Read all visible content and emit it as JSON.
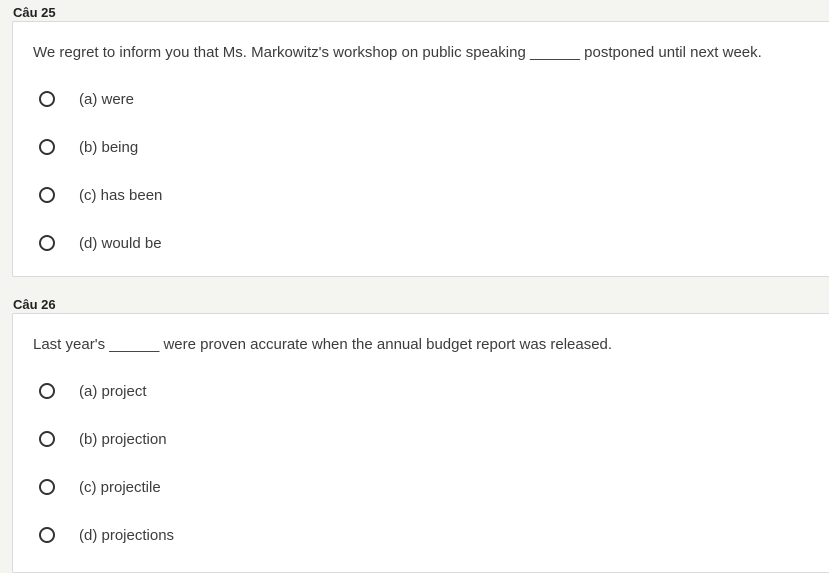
{
  "questions": [
    {
      "label": "Câu 25",
      "text": "We regret to inform you that Ms. Markowitz's workshop on public speaking ______ postponed until next week.",
      "options": [
        "(a) were",
        "(b) being",
        "(c) has been",
        "(d) would be"
      ]
    },
    {
      "label": "Câu 26",
      "text": "Last year's ______ were proven accurate when the annual budget report was released.",
      "options": [
        "(a) project",
        "(b) projection",
        "(c) projectile",
        "(d) projections"
      ]
    }
  ]
}
